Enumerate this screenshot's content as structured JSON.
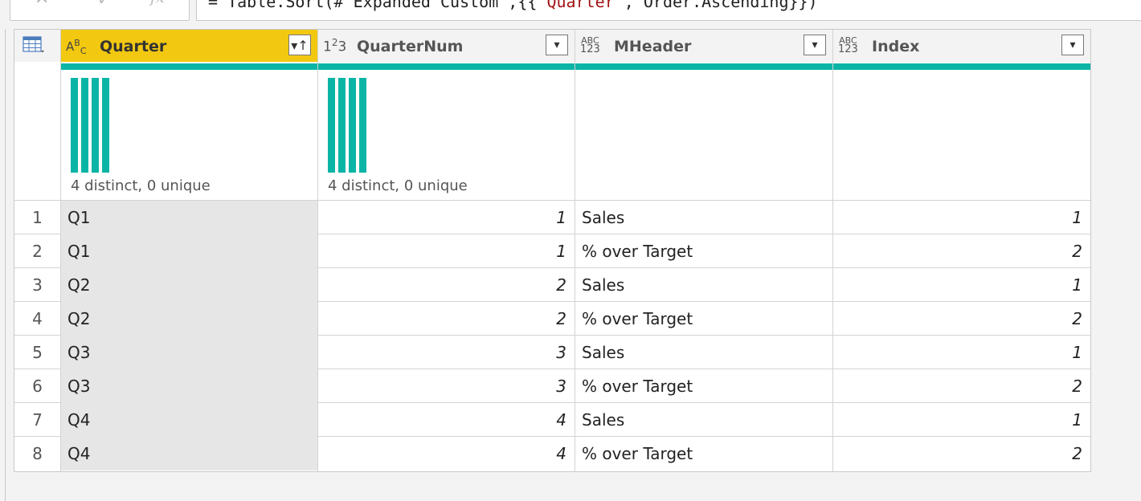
{
  "formula_bar": {
    "text_prefix": "= Table.Sort(#\"Expanded Custom\",{{",
    "text_string": "\"Quarter\"",
    "text_suffix": ", Order.Ascending}})"
  },
  "columns": [
    {
      "name": "Quarter",
      "type_icon": "ABC",
      "selected": true,
      "sorted_ascending": true
    },
    {
      "name": "QuarterNum",
      "type_icon": "123",
      "selected": false
    },
    {
      "name": "MHeader",
      "type_icon": "ABC/123",
      "selected": false
    },
    {
      "name": "Index",
      "type_icon": "ABC/123",
      "selected": false
    }
  ],
  "profiles": {
    "quarter": "4 distinct, 0 unique",
    "quarternum": "4 distinct, 0 unique"
  },
  "rows": [
    {
      "n": "1",
      "quarter": "Q1",
      "quarternum": "1",
      "mheader": "Sales",
      "index": "1"
    },
    {
      "n": "2",
      "quarter": "Q1",
      "quarternum": "1",
      "mheader": "% over Target",
      "index": "2"
    },
    {
      "n": "3",
      "quarter": "Q2",
      "quarternum": "2",
      "mheader": "Sales",
      "index": "1"
    },
    {
      "n": "4",
      "quarter": "Q2",
      "quarternum": "2",
      "mheader": "% over Target",
      "index": "2"
    },
    {
      "n": "5",
      "quarter": "Q3",
      "quarternum": "3",
      "mheader": "Sales",
      "index": "1"
    },
    {
      "n": "6",
      "quarter": "Q3",
      "quarternum": "3",
      "mheader": "% over Target",
      "index": "2"
    },
    {
      "n": "7",
      "quarter": "Q4",
      "quarternum": "4",
      "mheader": "Sales",
      "index": "1"
    },
    {
      "n": "8",
      "quarter": "Q4",
      "quarternum": "4",
      "mheader": "% over Target",
      "index": "2"
    }
  ],
  "colors": {
    "selected_header": "#f2c811",
    "quality_bar": "#0bb5a6",
    "selected_column_cells": "#e6e6e6"
  }
}
